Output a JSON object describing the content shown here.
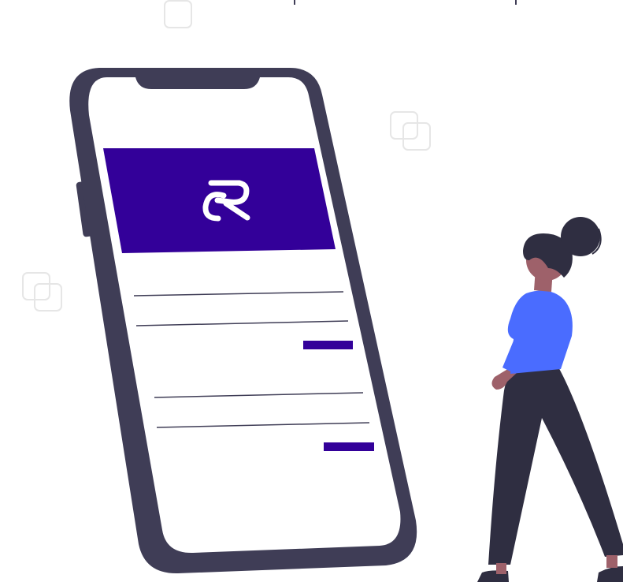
{
  "illustration": {
    "logo_mark": "R",
    "colors": {
      "phone_frame": "#3f3d56",
      "screen": "#ffffff",
      "brand_banner": "#330099",
      "logo": "#ffffff",
      "accent_bars": "#330099",
      "shirt": "#4a6cff",
      "pants": "#2f2e41",
      "hair": "#2f2e41",
      "skin": "#9e616a",
      "shoes": "#2f2e41",
      "deco_squares": "#e6e6e6"
    },
    "icons": [
      "decorative-square-icon",
      "overlapping-squares-icon",
      "logo-mark-icon"
    ]
  }
}
